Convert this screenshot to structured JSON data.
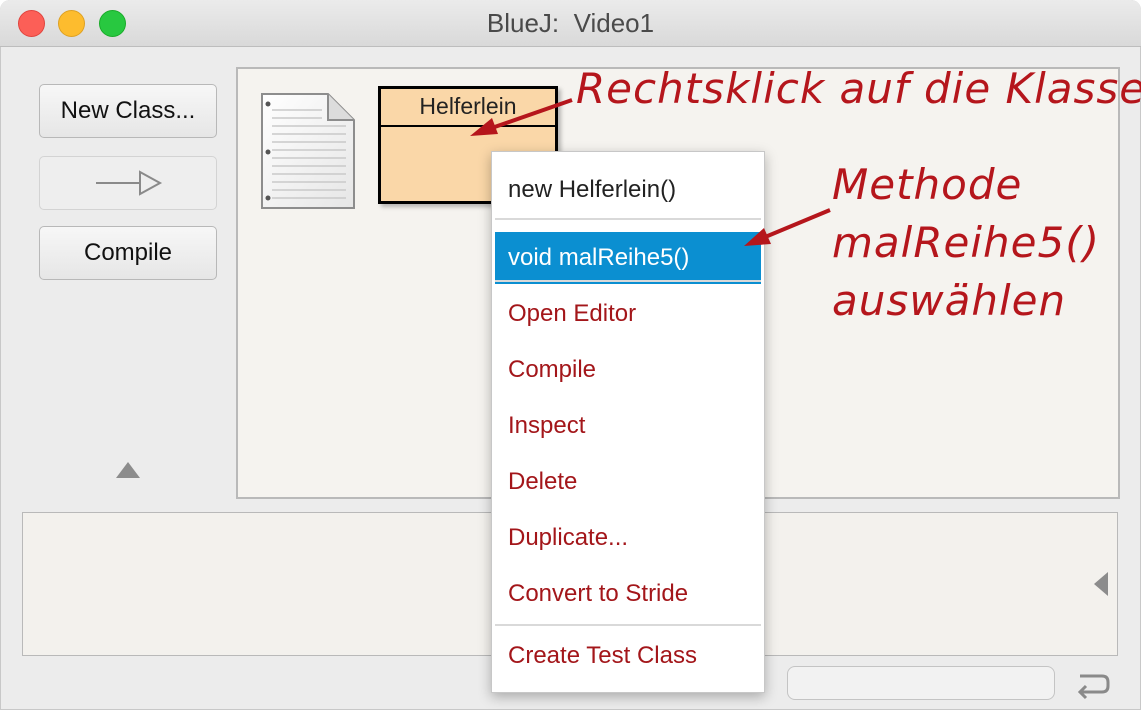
{
  "window": {
    "title": "BlueJ:  Video1"
  },
  "toolbar": {
    "new_class_label": "New Class...",
    "compile_label": "Compile"
  },
  "class": {
    "name": "Helferlein"
  },
  "context_menu": {
    "items": [
      {
        "label": "new Helferlein()"
      },
      {
        "label": "void malReihe5()"
      },
      {
        "label": "Open Editor"
      },
      {
        "label": "Compile"
      },
      {
        "label": "Inspect"
      },
      {
        "label": "Delete"
      },
      {
        "label": "Duplicate..."
      },
      {
        "label": "Convert to Stride"
      },
      {
        "label": "Create Test Class"
      }
    ]
  },
  "annotations": {
    "right_click": "Rechtsklick auf die Klasse",
    "method_line1": "Methode",
    "method_line2": "malReihe5()",
    "method_line3": "auswählen"
  },
  "colors": {
    "annotation": "#b5161c",
    "menu_selected": "#0b8fd1",
    "menu_text": "#a3161a",
    "class_fill": "#fad7a8"
  },
  "icons": {
    "readme": "readme-document-icon",
    "inherit_arrow": "inheritance-arrow-icon",
    "return": "return-arrow-icon"
  }
}
